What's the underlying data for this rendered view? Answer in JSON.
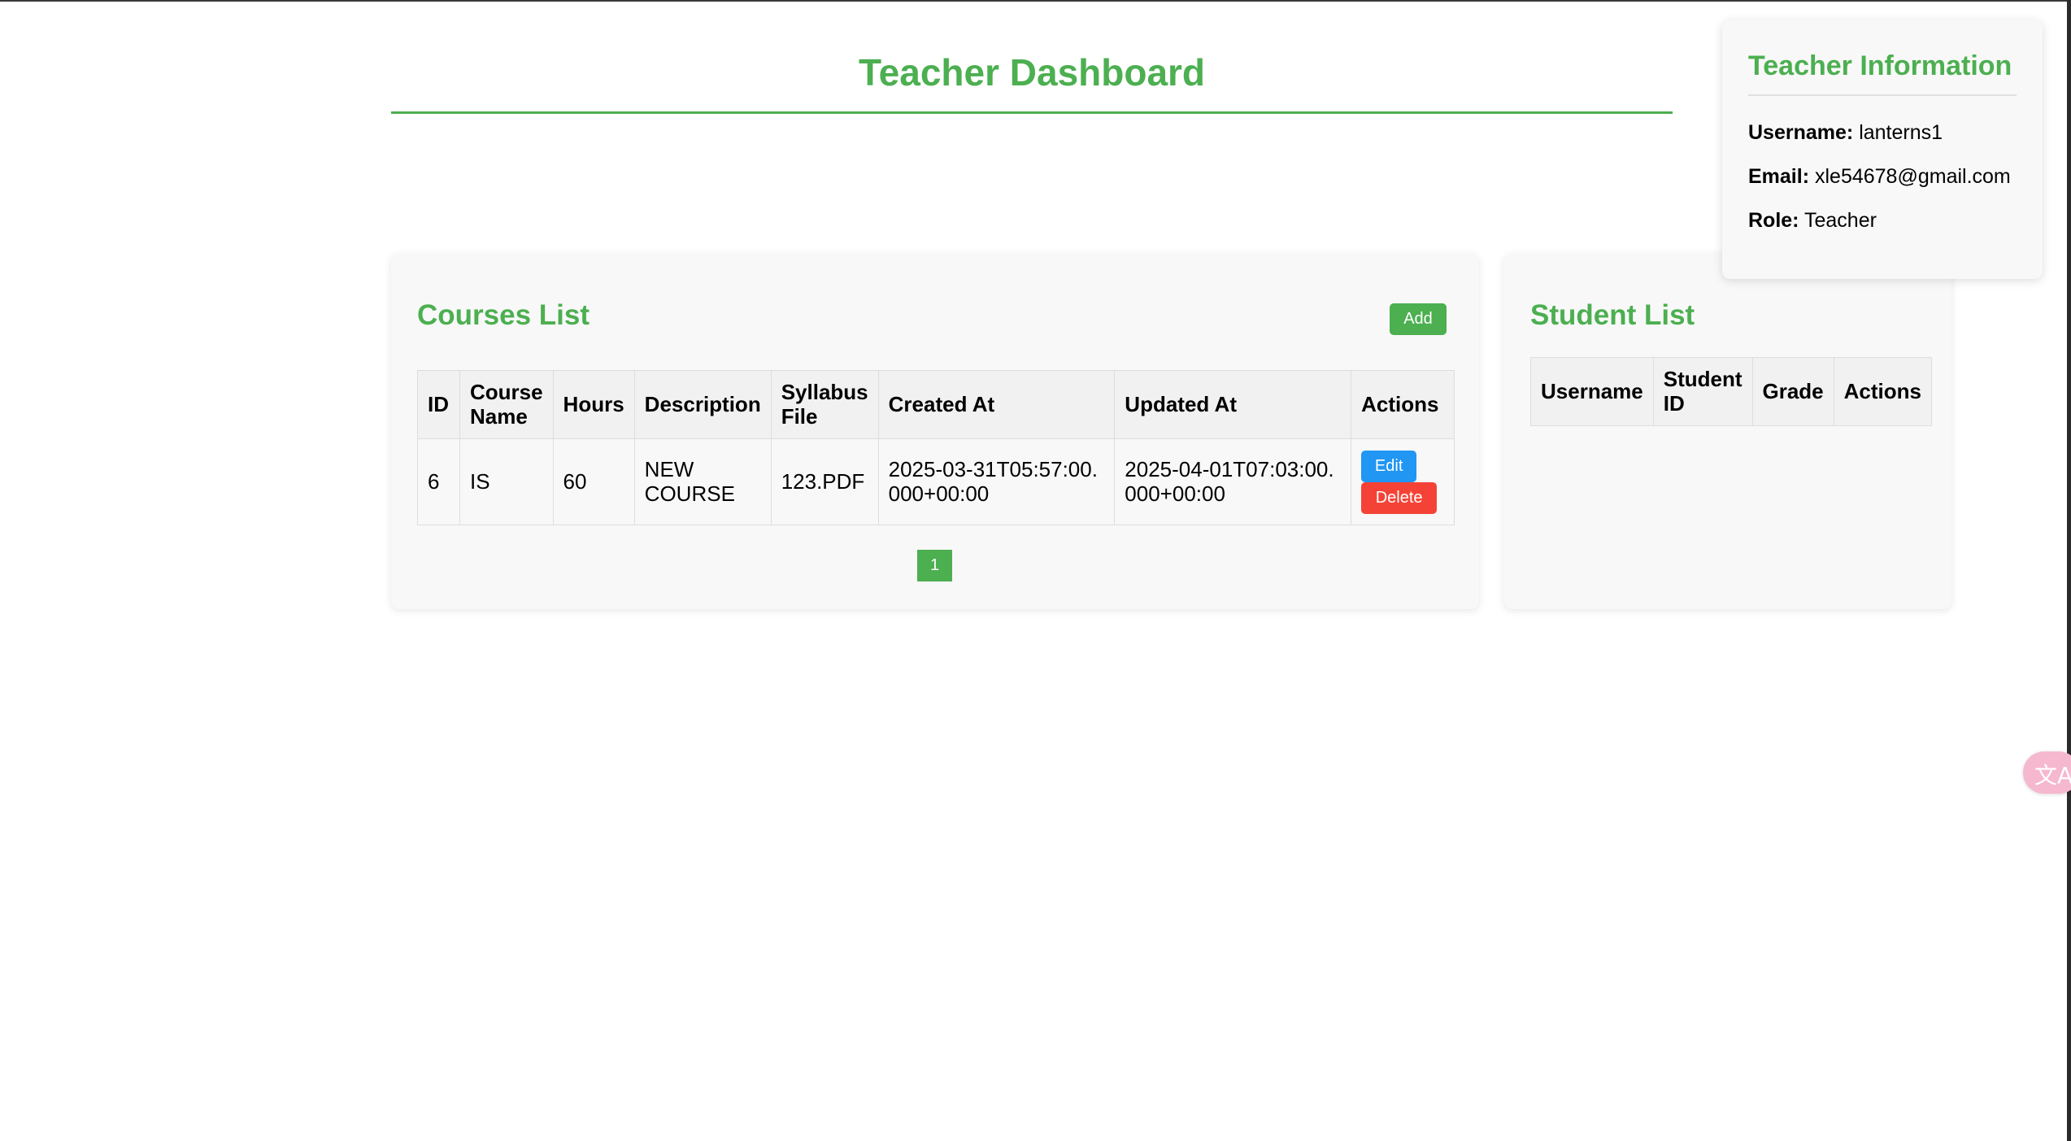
{
  "page": {
    "title": "Teacher Dashboard"
  },
  "courses": {
    "title": "Courses List",
    "add_label": "Add",
    "columns": [
      "ID",
      "Course Name",
      "Hours",
      "Description",
      "Syllabus File",
      "Created At",
      "Updated At",
      "Actions"
    ],
    "rows": [
      {
        "id": "6",
        "name": "IS",
        "hours": "60",
        "description": "NEW COURSE",
        "syllabus": "123.PDF",
        "created_at": "2025-03-31T05:57:00.000+00:00",
        "updated_at": "2025-04-01T07:03:00.000+00:00",
        "edit_label": "Edit",
        "delete_label": "Delete"
      }
    ],
    "pagination": {
      "current_page": "1"
    }
  },
  "students": {
    "title": "Student List",
    "columns": [
      "Username",
      "Student ID",
      "Grade",
      "Actions"
    ],
    "rows": []
  },
  "teacher_info": {
    "title": "Teacher Information",
    "username_label": "Username:",
    "username": "lanterns1",
    "email_label": "Email:",
    "email": "xle54678@gmail.com",
    "role_label": "Role:",
    "role": "Teacher"
  },
  "translate_widget": {
    "icon": "translate-icon",
    "glyph": "文A"
  },
  "colors": {
    "accent": "#4caf50",
    "edit": "#2196f3",
    "delete": "#f44336"
  }
}
